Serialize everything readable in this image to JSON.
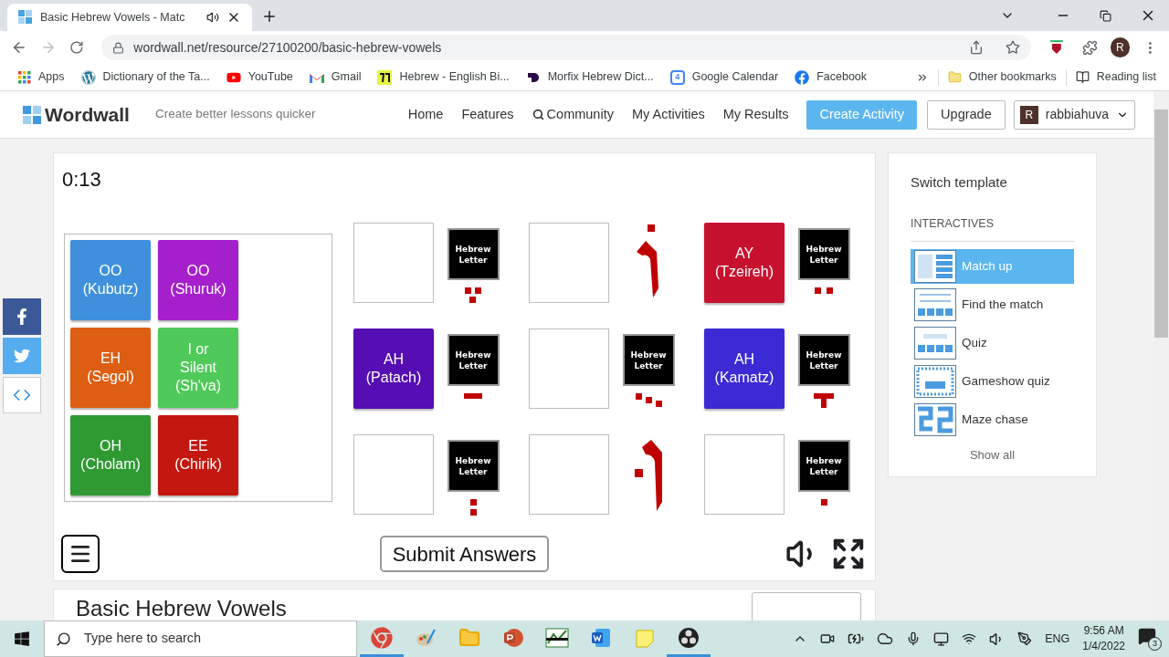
{
  "browser": {
    "tab": {
      "title": "Basic Hebrew Vowels - Matc",
      "audio": true
    },
    "url": "wordwall.net/resource/27100200/basic-hebrew-vowels",
    "profile": "R",
    "bookmarks": [
      {
        "label": "Apps",
        "kind": "apps"
      },
      {
        "label": "Dictionary of the Ta...",
        "kind": "wordpress"
      },
      {
        "label": "YouTube",
        "kind": "youtube"
      },
      {
        "label": "Gmail",
        "kind": "gmail"
      },
      {
        "label": "Hebrew - English Bi...",
        "kind": "hebrew"
      },
      {
        "label": "Morfix Hebrew Dict...",
        "kind": "morfix"
      },
      {
        "label": "Google Calendar",
        "kind": "calendar"
      },
      {
        "label": "Facebook",
        "kind": "facebook"
      }
    ],
    "calendar_day": "4",
    "other_bookmarks": "Other bookmarks",
    "reading_list": "Reading list"
  },
  "site": {
    "logo": "Wordwall",
    "tagline": "Create better lessons quicker",
    "nav": [
      {
        "label": "Home",
        "kind": "plain"
      },
      {
        "label": "Features",
        "kind": "plain"
      },
      {
        "label": "Community",
        "kind": "search"
      },
      {
        "label": "My Activities",
        "kind": "plain"
      },
      {
        "label": "My Results",
        "kind": "plain"
      }
    ],
    "create": "Create Activity",
    "upgrade": "Upgrade",
    "user": {
      "initial": "R",
      "name": "rabbiahuva"
    }
  },
  "game": {
    "timer": "0:13",
    "tray": [
      {
        "lines": [
          "OO",
          "(Kubutz)"
        ],
        "color": "#3f90dc"
      },
      {
        "lines": [
          "EH",
          "(Segol)"
        ],
        "color": "#dd5e12"
      },
      {
        "lines": [
          "OH",
          "(Cholam)"
        ],
        "color": "#2f9a32"
      },
      {
        "lines": [
          "OO",
          "(Shuruk)"
        ],
        "color": "#a61fcc"
      },
      {
        "lines": [
          "I or",
          "Silent",
          "(Sh'va)"
        ],
        "color": "#4fca5a"
      },
      {
        "lines": [
          "EE",
          "(Chirik)"
        ],
        "color": "#c3170f"
      }
    ],
    "slots": [
      {
        "clue": {
          "kind": "letter",
          "label": "Hebrew Letter",
          "mark": {
            "kind": "segol"
          }
        }
      },
      {
        "clue": {
          "kind": "vav",
          "mark": {
            "kind": "cholam"
          }
        }
      },
      {
        "tile": {
          "lines": [
            "AY",
            "(Tzeireh)"
          ],
          "color": "#c8112f"
        },
        "clue": {
          "kind": "letter",
          "label": "Hebrew Letter",
          "mark": {
            "kind": "tzeireh"
          }
        }
      },
      {
        "tile": {
          "lines": [
            "AH",
            "(Patach)"
          ],
          "color": "#560db3"
        },
        "clue": {
          "kind": "letter",
          "label": "Hebrew Letter",
          "mark": {
            "kind": "patach"
          }
        }
      },
      {
        "clue": {
          "kind": "letter",
          "label": "Hebrew Letter",
          "mark": {
            "kind": "kubutz"
          }
        }
      },
      {
        "tile": {
          "lines": [
            "AH",
            "(Kamatz)"
          ],
          "color": "#3a2bd4"
        },
        "clue": {
          "kind": "letter",
          "label": "Hebrew Letter",
          "mark": {
            "kind": "kamatz"
          }
        }
      },
      {
        "clue": {
          "kind": "letter",
          "label": "Hebrew Letter",
          "mark": {
            "kind": "sheva"
          }
        }
      },
      {
        "clue": {
          "kind": "vav",
          "mark": {
            "kind": "shuruk"
          }
        }
      },
      {
        "clue": {
          "kind": "letter",
          "label": "Hebrew Letter",
          "mark": {
            "kind": "chirik"
          }
        }
      }
    ],
    "submit": "Submit Answers"
  },
  "activity_title": "Basic Hebrew Vowels",
  "templates": {
    "title": "Switch template",
    "section": "INTERACTIVES",
    "items": [
      {
        "label": "Match up",
        "selected": true,
        "kind": "matchup"
      },
      {
        "label": "Find the match",
        "selected": false,
        "kind": "find"
      },
      {
        "label": "Quiz",
        "selected": false,
        "kind": "quiz"
      },
      {
        "label": "Gameshow quiz",
        "selected": false,
        "kind": "gameshow"
      },
      {
        "label": "Maze chase",
        "selected": false,
        "kind": "maze"
      }
    ],
    "show_all": "Show all"
  },
  "taskbar": {
    "search_placeholder": "Type here to search",
    "apps": [
      {
        "kind": "chrome",
        "active": true
      },
      {
        "kind": "paint",
        "active": false
      },
      {
        "kind": "explorer",
        "active": false
      },
      {
        "kind": "powerpoint",
        "active": false
      },
      {
        "kind": "sheet",
        "active": false
      },
      {
        "kind": "word",
        "active": false
      },
      {
        "kind": "notes",
        "active": false
      },
      {
        "kind": "obs",
        "active": true
      }
    ],
    "language": "ENG",
    "time": "9:56 AM",
    "date": "1/4/2022",
    "notifications": "3"
  }
}
